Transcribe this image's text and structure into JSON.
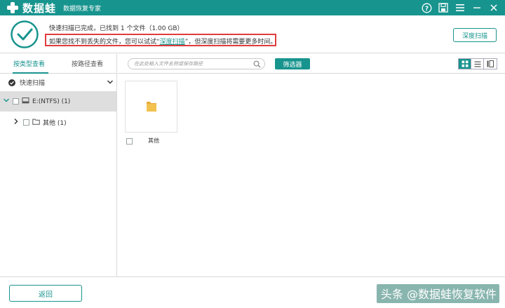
{
  "app": {
    "name": "数据蛙",
    "subtitle": "数据恢复专家"
  },
  "header": {
    "status_line": "快速扫描已完成，已找到 1 个文件（1.00 GB）",
    "hint_prefix": "如果您找不到丢失的文件，您可以试试“",
    "hint_link": "深度扫描",
    "hint_suffix": "”，但深度扫描将需要更多时间。",
    "deep_scan_button": "深度扫描"
  },
  "sidebar": {
    "tabs": [
      "按类型查看",
      "按路径查看"
    ],
    "active_tab": 0,
    "scan_mode": "快速扫描",
    "drive": "E:(NTFS) (1)",
    "folder": "其他 (1)"
  },
  "toolbar": {
    "search_placeholder": "在此处输入文件名称或保存路径",
    "filter_button": "筛选器"
  },
  "content": {
    "items": [
      {
        "label": "其他",
        "icon": "folder-icon"
      }
    ]
  },
  "footer": {
    "back_button": "返回",
    "watermark": "头条 @数据蛙恢复软件"
  },
  "colors": {
    "accent": "#18948e",
    "highlight_border": "#e03c3c",
    "folder": "#f2c14e"
  }
}
